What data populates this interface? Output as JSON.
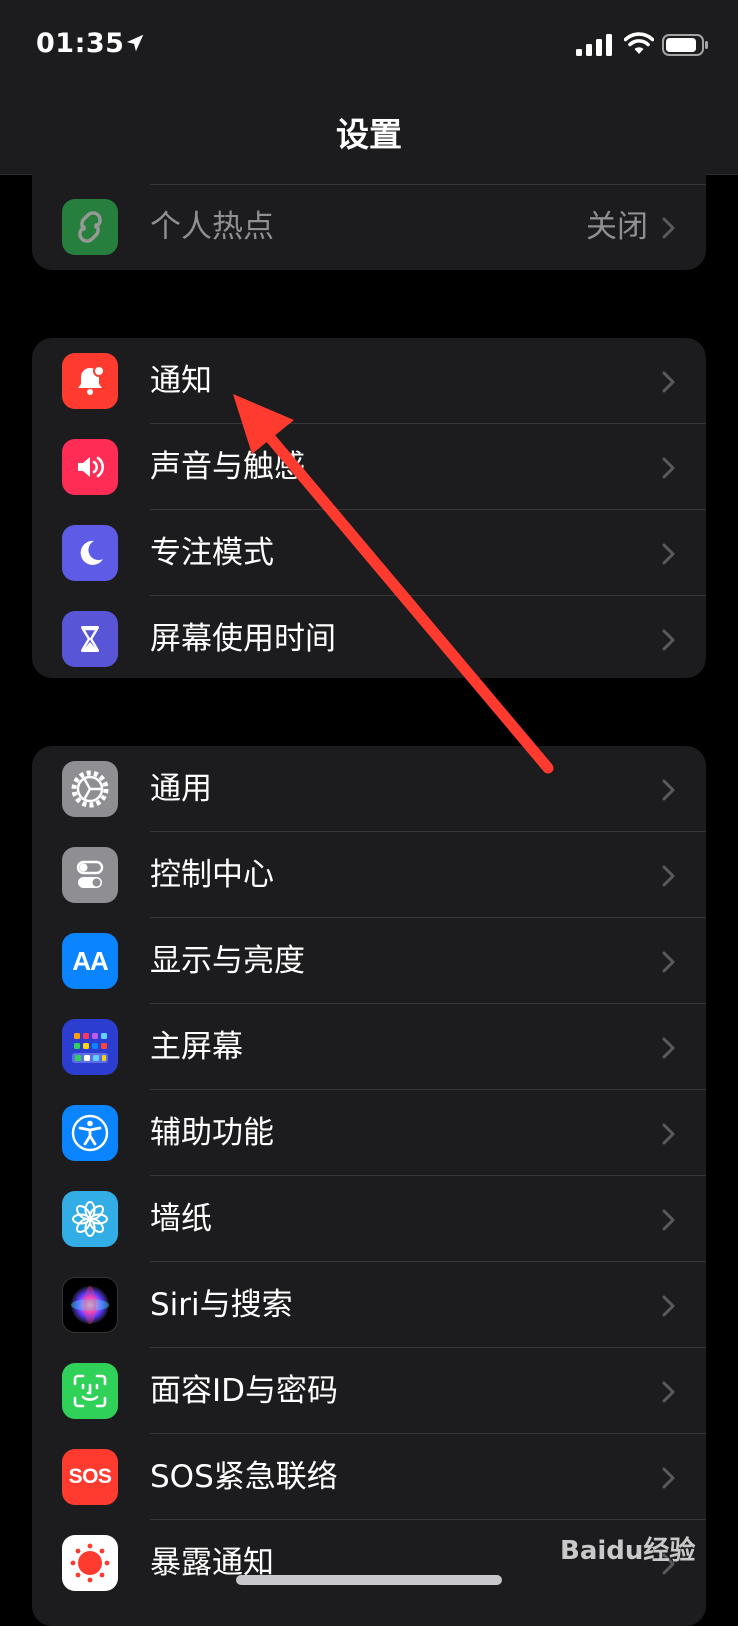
{
  "status": {
    "time": "01:35"
  },
  "nav": {
    "title": "设置"
  },
  "group0": {
    "items": [
      {
        "label": "个人热点",
        "value": "关闭"
      }
    ]
  },
  "group1": {
    "items": [
      {
        "label": "通知"
      },
      {
        "label": "声音与触感"
      },
      {
        "label": "专注模式"
      },
      {
        "label": "屏幕使用时间"
      }
    ]
  },
  "group2": {
    "items": [
      {
        "label": "通用"
      },
      {
        "label": "控制中心"
      },
      {
        "label": "显示与亮度"
      },
      {
        "label": "主屏幕"
      },
      {
        "label": "辅助功能"
      },
      {
        "label": "墙纸"
      },
      {
        "label": "Siri与搜索"
      },
      {
        "label": "面容ID与密码"
      },
      {
        "label": "SOS紧急联络"
      },
      {
        "label": "暴露通知"
      }
    ]
  },
  "icons": {
    "display_text": "AA",
    "sos_text": "SOS"
  },
  "watermark": "Baidu经验",
  "colors": {
    "hotspot": "#30d158",
    "notifications": "#ff3b30",
    "sounds": "#ff2d55",
    "focus": "#5e5ce6",
    "screentime": "#5856d6",
    "general": "#8e8e93",
    "control": "#8e8e93",
    "display": "#0a84ff",
    "homescreen": "#2c3ecf",
    "accessibility": "#0a84ff",
    "wallpaper": "#32ade6",
    "faceid": "#30d158",
    "sos": "#ff3b30",
    "exposure": "#ffffff",
    "annotation_arrow": "#ff3b30"
  }
}
